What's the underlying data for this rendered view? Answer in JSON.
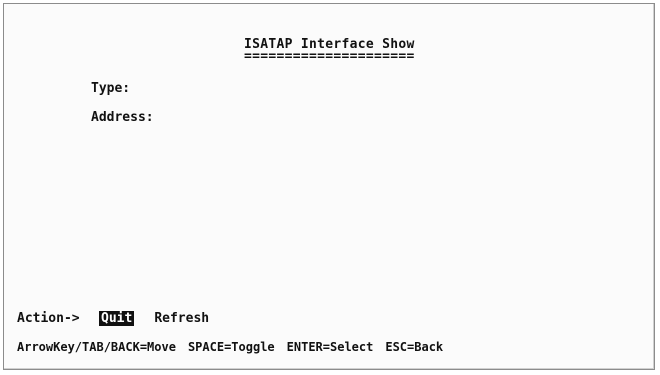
{
  "screen": {
    "title": "ISATAP Interface Show",
    "title_underline": "====================="
  },
  "fields": {
    "type_label": "Type:",
    "address_label": "Address:"
  },
  "actions": {
    "label": "Action->",
    "quit": "Quit",
    "refresh": "Refresh"
  },
  "help": {
    "move": "ArrowKey/TAB/BACK=Move",
    "toggle": "SPACE=Toggle",
    "select": "ENTER=Select",
    "back": "ESC=Back"
  },
  "colors": {
    "selected_bg": "#111111",
    "selected_fg": "#ffffff",
    "text": "#111111",
    "background": "#fbfbfb"
  }
}
